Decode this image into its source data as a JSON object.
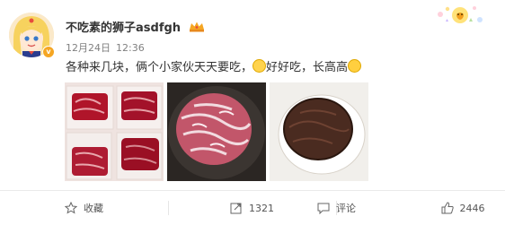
{
  "user": {
    "name": "不吃素的狮子asdfgh",
    "avatar_icon": "cartoon-girl-avatar",
    "verified_color": "#f5a623"
  },
  "post": {
    "date": "12月24日",
    "time": "12:36",
    "text_part1": "各种来几块，俩个小家伙天天要吃，",
    "text_part2": "好好吃，长高高",
    "emoji_1": "drool-face-emoji",
    "emoji_2": "grin-face-emoji"
  },
  "photos": [
    {
      "name": "raw-steak-boxes-photo"
    },
    {
      "name": "marbled-steak-in-pan-photo"
    },
    {
      "name": "cooked-steak-on-plate-photo"
    }
  ],
  "actions": {
    "favorite_label": "收藏",
    "repost_count": "1321",
    "comment_label": "评论",
    "like_count": "2446"
  },
  "theme": {
    "text_color": "#333333",
    "meta_color": "#808080"
  }
}
